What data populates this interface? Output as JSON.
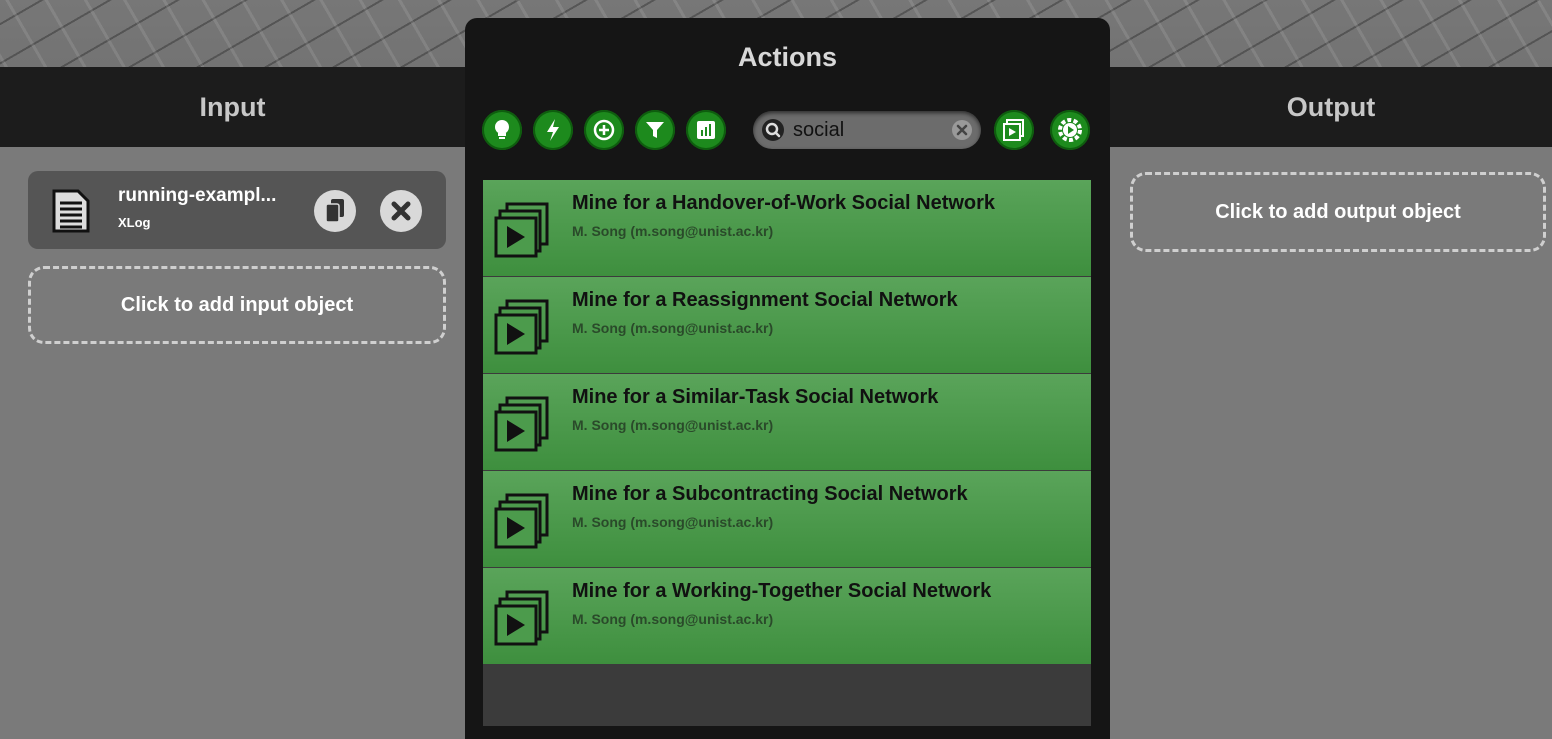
{
  "input_panel": {
    "title": "Input",
    "item": {
      "name": "running-exampl...",
      "type": "XLog"
    },
    "add_label": "Click to add input object"
  },
  "actions_panel": {
    "title": "Actions",
    "search": {
      "value": "social"
    },
    "items": [
      {
        "title": "Mine for a Handover-of-Work Social Network",
        "author": "M. Song (m.song@unist.ac.kr)"
      },
      {
        "title": "Mine for a Reassignment Social Network",
        "author": "M. Song (m.song@unist.ac.kr)"
      },
      {
        "title": "Mine for a Similar-Task Social Network",
        "author": "M. Song (m.song@unist.ac.kr)"
      },
      {
        "title": "Mine for a Subcontracting Social Network",
        "author": "M. Song (m.song@unist.ac.kr)"
      },
      {
        "title": "Mine for a Working-Together Social Network",
        "author": "M. Song (m.song@unist.ac.kr)"
      }
    ]
  },
  "output_panel": {
    "title": "Output",
    "add_label": "Click to add output object"
  },
  "colors": {
    "accent_green": "#1d8a1d",
    "item_green": "#4c9b4c",
    "header": "#1c1c1c"
  }
}
